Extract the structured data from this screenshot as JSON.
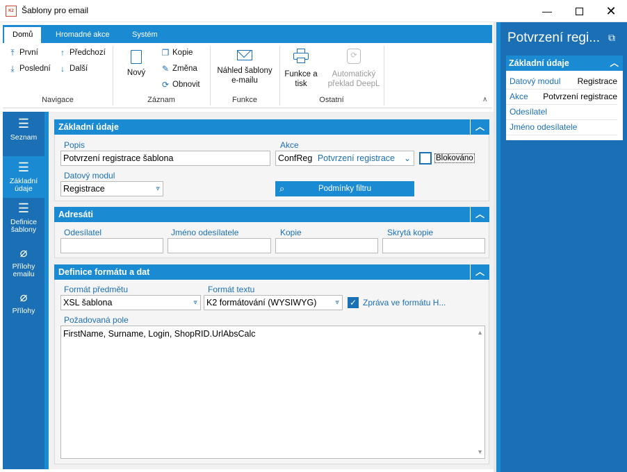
{
  "window": {
    "title": "Šablony pro email",
    "logo": "K2"
  },
  "ribbon": {
    "tabs": [
      "Domů",
      "Hromadné akce",
      "Systém"
    ],
    "navigace": {
      "prvni": "První",
      "posledni": "Poslední",
      "predchozi": "Předchozí",
      "dalsi": "Další",
      "caption": "Navigace"
    },
    "zaznam": {
      "novy": "Nový",
      "kopie": "Kopie",
      "zmena": "Změna",
      "obnovit": "Obnovit",
      "caption": "Záznam"
    },
    "funkce": {
      "nahled_line1": "Náhled šablony",
      "nahled_line2": "e-mailu",
      "caption": "Funkce"
    },
    "ostatni": {
      "funkce_tisk_line1": "Funkce a",
      "funkce_tisk_line2": "tisk",
      "deepl_line1": "Automatický",
      "deepl_line2": "překlad DeepL",
      "caption": "Ostatní"
    }
  },
  "nav": {
    "seznam": "Seznam",
    "zakladni_l1": "Základní",
    "zakladni_l2": "údaje",
    "definice_l1": "Definice",
    "definice_l2": "šablony",
    "prilohy_emailu_l1": "Přílohy",
    "prilohy_emailu_l2": "emailu",
    "prilohy": "Přílohy"
  },
  "zakladni": {
    "title": "Základní údaje",
    "popis_label": "Popis",
    "popis_value": "Potvrzení registrace šablona",
    "akce_label": "Akce",
    "akce_code": "ConfReg",
    "akce_value": "Potvrzení registrace",
    "blokovano": "Blokováno",
    "modul_label": "Datový modul",
    "modul_value": "Registrace",
    "filtr_button": "Podmínky filtru"
  },
  "adresati": {
    "title": "Adresáti",
    "odesilatel": "Odesílatel",
    "jmeno": "Jméno odesílatele",
    "kopie": "Kopie",
    "skryta": "Skrytá kopie"
  },
  "definice": {
    "title": "Definice formátu a dat",
    "format_predmetu_label": "Formát předmětu",
    "format_predmetu_value": "XSL šablona",
    "format_textu_label": "Formát textu",
    "format_textu_value": "K2 formátování (WYSIWYG)",
    "zprava": "Zpráva ve formátu H...",
    "pole_label": "Požadovaná pole",
    "pole_value": "FirstName, Surname, Login, ShopRID.UrlAbsCalc"
  },
  "right_panel": {
    "title": "Potvrzení regi...",
    "section": "Základní údaje",
    "rows": [
      {
        "label": "Datový modul",
        "value": "Registrace"
      },
      {
        "label": "Akce",
        "value": "Potvrzení registrace"
      },
      {
        "label": "Odesílatel",
        "value": ""
      },
      {
        "label": "Jméno odesílatele",
        "value": ""
      }
    ]
  },
  "colors": {
    "accent": "#1a8ad2",
    "nav": "#1a6fb5"
  }
}
